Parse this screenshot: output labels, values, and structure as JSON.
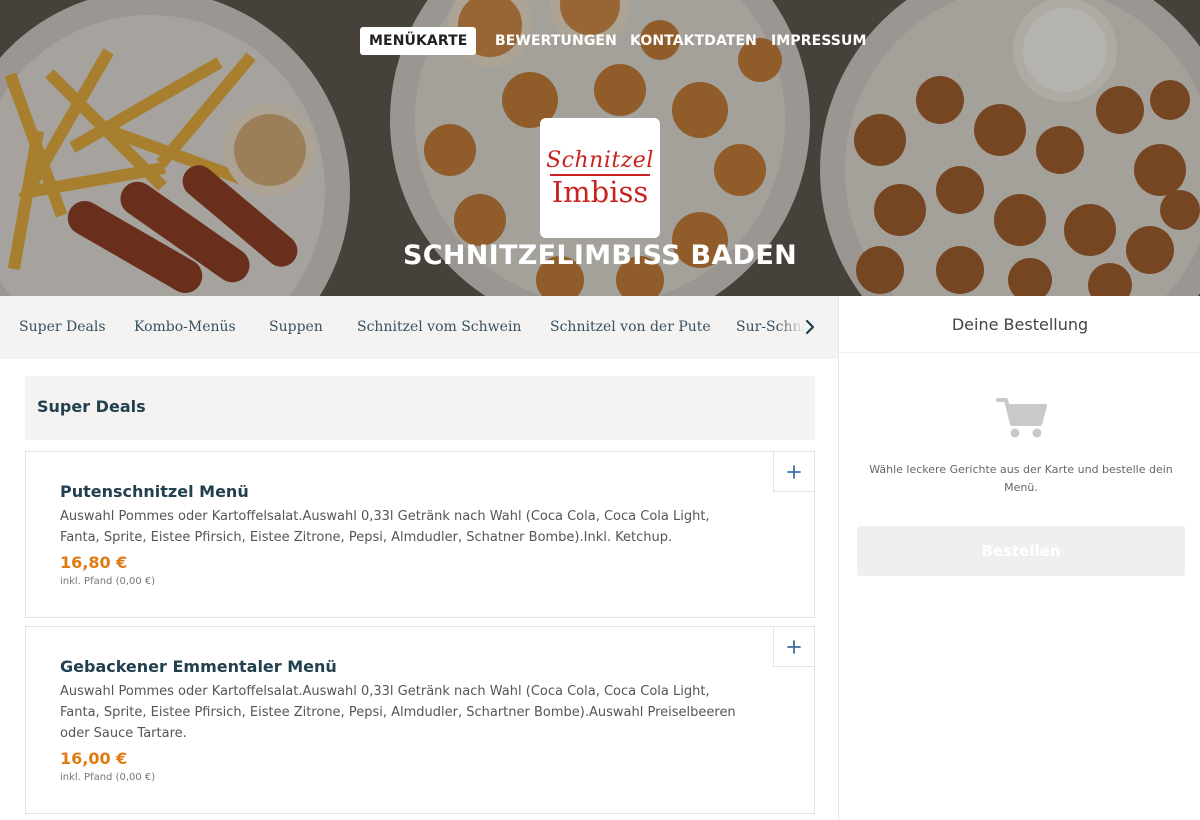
{
  "nav": {
    "items": [
      "MENÜKARTE",
      "BEWERTUNGEN",
      "KONTAKTDATEN",
      "IMPRESSUM"
    ],
    "active": "MENÜKARTE"
  },
  "logo": {
    "line1": "Schnitzel",
    "line2": "Imbiss"
  },
  "restaurant": {
    "name": "SCHNITZELIMBISS BADEN"
  },
  "categories": [
    "Super Deals",
    "Kombo-Menüs",
    "Suppen",
    "Schnitzel vom Schwein",
    "Schnitzel von der Pute",
    "Sur-Schnitzel"
  ],
  "section": {
    "title": "Super Deals"
  },
  "dishes": [
    {
      "name": "Putenschnitzel Menü",
      "description": "Auswahl Pommes oder Kartoffelsalat.Auswahl 0,33l Getränk nach Wahl (Coca Cola, Coca Cola Light, Fanta, Sprite, Eistee Pfirsich, Eistee Zitrone, Pepsi, Almdudler, Schatner Bombe).Inkl. Ketchup.",
      "price": "16,80 €",
      "deposit": "inkl. Pfand (0,00 €)",
      "add_label": "+"
    },
    {
      "name": "Gebackener Emmentaler Menü",
      "description": "Auswahl Pommes oder Kartoffelsalat.Auswahl 0,33l Getränk nach Wahl (Coca Cola, Coca Cola Light, Fanta, Sprite, Eistee Pfirsich, Eistee Zitrone, Pepsi, Almdudler, Schartner Bombe).Auswahl Preiselbeeren oder Sauce Tartare.",
      "price": "16,00 €",
      "deposit": "inkl. Pfand (0,00 €)",
      "add_label": "+"
    }
  ],
  "order": {
    "title": "Deine Bestellung",
    "empty_text": "Wähle leckere Gerichte aus der Karte und bestelle dein Menü.",
    "checkout_label": "Bestellen",
    "cart_icon": "cart-icon"
  },
  "colors": {
    "accent_price": "#e07b13",
    "heading": "#22404f",
    "brand_red": "#c8241f",
    "category_bg": "#f5f3f1"
  }
}
